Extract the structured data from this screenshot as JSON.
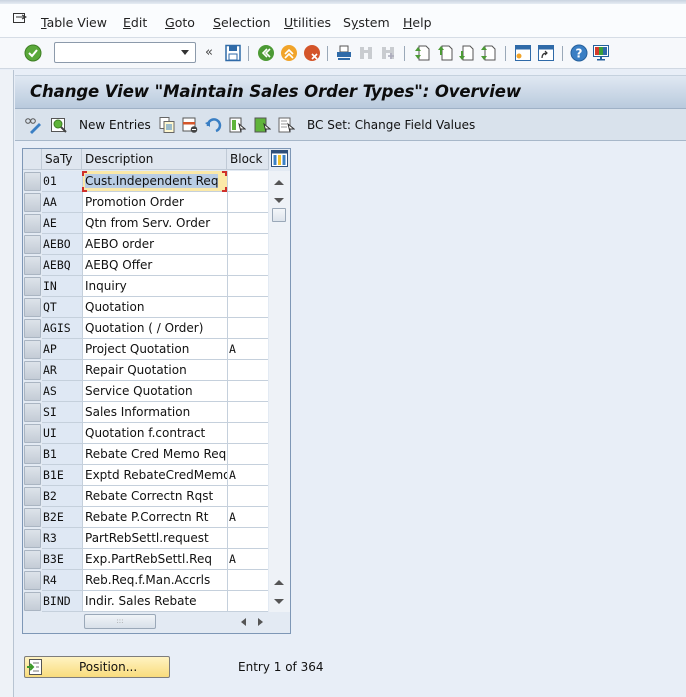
{
  "menubar": {
    "items": [
      {
        "label": "Table View",
        "mnemonic": "T"
      },
      {
        "label": "Edit",
        "mnemonic": "E"
      },
      {
        "label": "Goto",
        "mnemonic": "G"
      },
      {
        "label": "Selection",
        "mnemonic": "S"
      },
      {
        "label": "Utilities",
        "mnemonic": "U"
      },
      {
        "label": "System",
        "mnemonic": "y"
      },
      {
        "label": "Help",
        "mnemonic": "H"
      }
    ]
  },
  "toolbar": {
    "command_field": {
      "value": "",
      "placeholder": ""
    },
    "icons": [
      "enter-check-icon",
      "command-dropdown-icon",
      "collapse-icon",
      "save-icon",
      "back-icon",
      "exit-icon",
      "cancel-icon",
      "print-icon",
      "find-icon",
      "find-next-icon",
      "first-page-icon",
      "previous-page-icon",
      "next-page-icon",
      "last-page-icon",
      "create-session-icon",
      "create-shortcut-icon",
      "help-icon",
      "customize-layout-icon"
    ]
  },
  "title": "Change View \"Maintain Sales Order Types\": Overview",
  "app_toolbar": {
    "new_entries_label": "New Entries",
    "bc_set_label": "BC Set: Change Field Values"
  },
  "table": {
    "columns": [
      "SaTy",
      "Description",
      "Block"
    ],
    "rows": [
      {
        "saty": "01",
        "desc": "Cust.Independent Req",
        "block": ""
      },
      {
        "saty": "AA",
        "desc": "Promotion Order",
        "block": ""
      },
      {
        "saty": "AE",
        "desc": "Qtn from Serv. Order",
        "block": ""
      },
      {
        "saty": "AEBO",
        "desc": "AEBO order",
        "block": ""
      },
      {
        "saty": "AEBQ",
        "desc": "AEBQ Offer",
        "block": ""
      },
      {
        "saty": "IN",
        "desc": "Inquiry",
        "block": ""
      },
      {
        "saty": "QT",
        "desc": "Quotation",
        "block": ""
      },
      {
        "saty": "AGIS",
        "desc": "Quotation ( / Order)",
        "block": ""
      },
      {
        "saty": "AP",
        "desc": "Project Quotation",
        "block": "A"
      },
      {
        "saty": "AR",
        "desc": "Repair Quotation",
        "block": ""
      },
      {
        "saty": "AS",
        "desc": "Service Quotation",
        "block": ""
      },
      {
        "saty": "SI",
        "desc": "Sales Information",
        "block": ""
      },
      {
        "saty": "UI",
        "desc": "Quotation f.contract",
        "block": ""
      },
      {
        "saty": "B1",
        "desc": "Rebate Cred Memo Req",
        "block": ""
      },
      {
        "saty": "B1E",
        "desc": "Exptd RebateCredMemo",
        "block": "A"
      },
      {
        "saty": "B2",
        "desc": "Rebate Correctn Rqst",
        "block": ""
      },
      {
        "saty": "B2E",
        "desc": "Rebate P.Correctn Rt",
        "block": "A"
      },
      {
        "saty": "R3",
        "desc": "PartRebSettl.request",
        "block": ""
      },
      {
        "saty": "B3E",
        "desc": "Exp.PartRebSettl.Req",
        "block": "A"
      },
      {
        "saty": "R4",
        "desc": "Reb.Req.f.Man.Accrls",
        "block": ""
      },
      {
        "saty": "BIND",
        "desc": "Indir. Sales Rebate",
        "block": ""
      }
    ]
  },
  "footer": {
    "position_button_label": "Position...",
    "entry_info": "Entry 1 of 364"
  },
  "colors": {
    "focus_cell": "#fbe9a8",
    "selected_text": "#b9cde4",
    "focus_corner": "#d0302a",
    "position_button": "#f9dc7d"
  }
}
